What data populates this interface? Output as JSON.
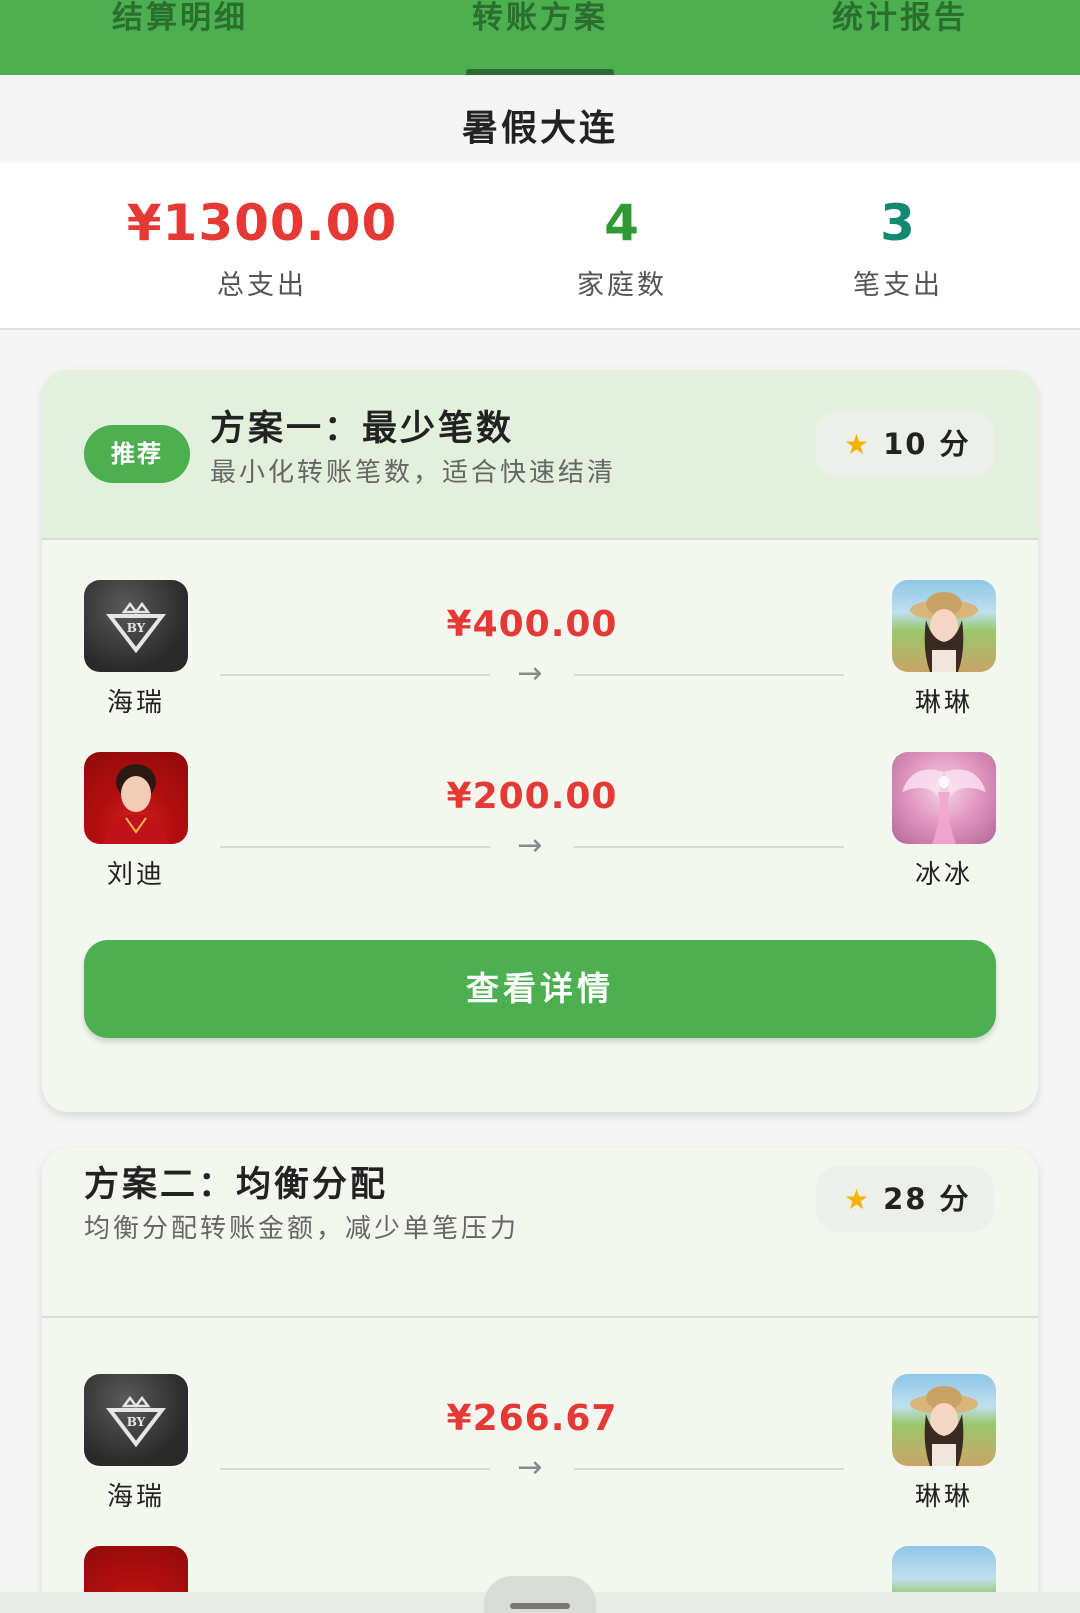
{
  "tabs": [
    {
      "label": "结算明细"
    },
    {
      "label": "转账方案"
    },
    {
      "label": "统计报告"
    }
  ],
  "trip_title": "暑假大连",
  "stats": {
    "total": {
      "value": "¥1300.00",
      "label": "总支出"
    },
    "families": {
      "value": "4",
      "label": "家庭数"
    },
    "expenses": {
      "value": "3",
      "label": "笔支出"
    }
  },
  "plans": [
    {
      "badge": "推荐",
      "title": "方案一：最少笔数",
      "desc": "最小化转账笔数，适合快速结清",
      "score": "10 分",
      "transfers": [
        {
          "from": "海瑞",
          "to": "琳琳",
          "amount": "¥400.00"
        },
        {
          "from": "刘迪",
          "to": "冰冰",
          "amount": "¥200.00"
        }
      ],
      "button": "查看详情"
    },
    {
      "title": "方案二：均衡分配",
      "desc": "均衡分配转账金额，减少单笔压力",
      "score": "28 分",
      "transfers": [
        {
          "from": "海瑞",
          "to": "琳琳",
          "amount": "¥266.67"
        }
      ]
    }
  ],
  "icons": {
    "arrow": "→",
    "star": "★"
  },
  "colors": {
    "primary_green": "#4caf50",
    "amount_red": "#e53935",
    "star_yellow": "#f5b301"
  }
}
